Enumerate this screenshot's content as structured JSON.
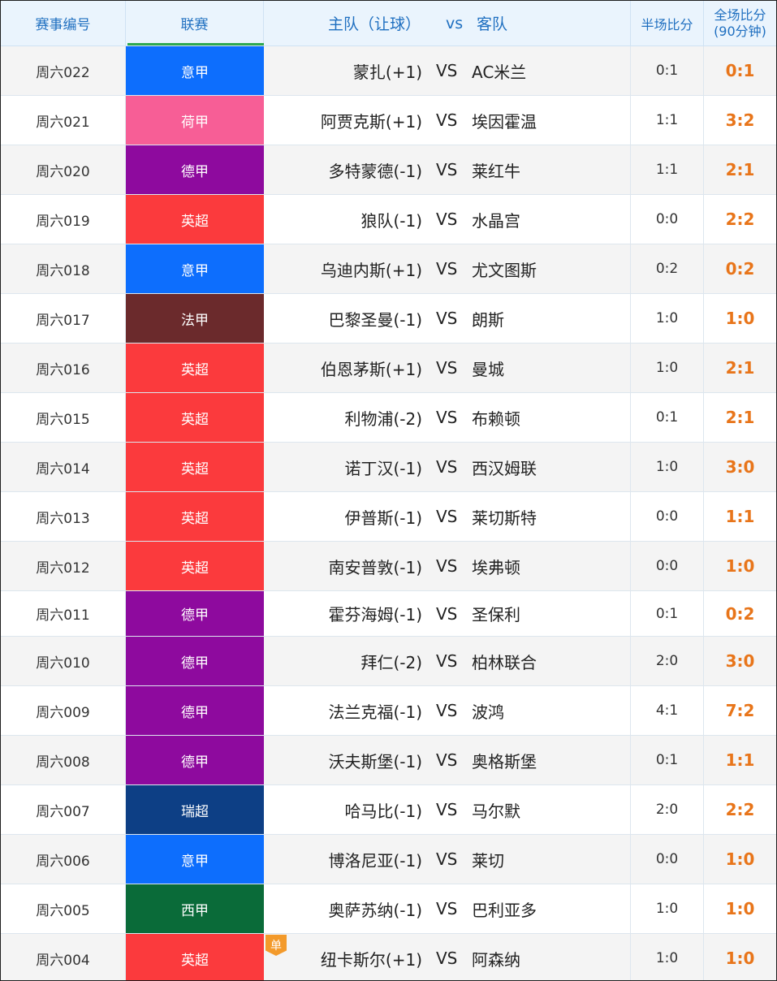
{
  "header": {
    "id": "赛事编号",
    "league": "联赛",
    "home": "主队（让球）",
    "vs": "vs",
    "away": "客队",
    "half": "半场比分",
    "full_line1": "全场比分",
    "full_line2": "(90分钟)"
  },
  "league_colors": {
    "意甲": "#0d6efd",
    "荷甲": "#f75e96",
    "德甲": "#8e0a9e",
    "英超": "#fb3a3d",
    "法甲": "#6b2a2c",
    "瑞超": "#0d3f85",
    "西甲": "#0a6b39"
  },
  "score_color": "#e8751a",
  "single_tag": "单",
  "rows": [
    {
      "id": "周六022",
      "league": "意甲",
      "home": "蒙扎(+1)",
      "vs": "VS",
      "away": "AC米兰",
      "half": "0:1",
      "full": "0:1"
    },
    {
      "id": "周六021",
      "league": "荷甲",
      "home": "阿贾克斯(+1)",
      "vs": "VS",
      "away": "埃因霍温",
      "half": "1:1",
      "full": "3:2"
    },
    {
      "id": "周六020",
      "league": "德甲",
      "home": "多特蒙德(-1)",
      "vs": "VS",
      "away": "莱红牛",
      "half": "1:1",
      "full": "2:1"
    },
    {
      "id": "周六019",
      "league": "英超",
      "home": "狼队(-1)",
      "vs": "VS",
      "away": "水晶宫",
      "half": "0:0",
      "full": "2:2"
    },
    {
      "id": "周六018",
      "league": "意甲",
      "home": "乌迪内斯(+1)",
      "vs": "VS",
      "away": "尤文图斯",
      "half": "0:2",
      "full": "0:2"
    },
    {
      "id": "周六017",
      "league": "法甲",
      "home": "巴黎圣曼(-1)",
      "vs": "VS",
      "away": "朗斯",
      "half": "1:0",
      "full": "1:0"
    },
    {
      "id": "周六016",
      "league": "英超",
      "home": "伯恩茅斯(+1)",
      "vs": "VS",
      "away": "曼城",
      "half": "1:0",
      "full": "2:1"
    },
    {
      "id": "周六015",
      "league": "英超",
      "home": "利物浦(-2)",
      "vs": "VS",
      "away": "布赖顿",
      "half": "0:1",
      "full": "2:1"
    },
    {
      "id": "周六014",
      "league": "英超",
      "home": "诺丁汉(-1)",
      "vs": "VS",
      "away": "西汉姆联",
      "half": "1:0",
      "full": "3:0"
    },
    {
      "id": "周六013",
      "league": "英超",
      "home": "伊普斯(-1)",
      "vs": "VS",
      "away": "莱切斯特",
      "half": "0:0",
      "full": "1:1"
    },
    {
      "id": "周六012",
      "league": "英超",
      "home": "南安普敦(-1)",
      "vs": "VS",
      "away": "埃弗顿",
      "half": "0:0",
      "full": "1:0"
    },
    {
      "id": "周六011",
      "league": "德甲",
      "home": "霍芬海姆(-1)",
      "vs": "VS",
      "away": "圣保利",
      "half": "0:1",
      "full": "0:2"
    },
    {
      "id": "周六010",
      "league": "德甲",
      "home": "拜仁(-2)",
      "vs": "VS",
      "away": "柏林联合",
      "half": "2:0",
      "full": "3:0"
    },
    {
      "id": "周六009",
      "league": "德甲",
      "home": "法兰克福(-1)",
      "vs": "VS",
      "away": "波鸿",
      "half": "4:1",
      "full": "7:2"
    },
    {
      "id": "周六008",
      "league": "德甲",
      "home": "沃夫斯堡(-1)",
      "vs": "VS",
      "away": "奥格斯堡",
      "half": "0:1",
      "full": "1:1"
    },
    {
      "id": "周六007",
      "league": "瑞超",
      "home": "哈马比(-1)",
      "vs": "VS",
      "away": "马尔默",
      "half": "2:0",
      "full": "2:2"
    },
    {
      "id": "周六006",
      "league": "意甲",
      "home": "博洛尼亚(-1)",
      "vs": "VS",
      "away": "莱切",
      "half": "0:0",
      "full": "1:0"
    },
    {
      "id": "周六005",
      "league": "西甲",
      "home": "奥萨苏纳(-1)",
      "vs": "VS",
      "away": "巴利亚多",
      "half": "1:0",
      "full": "1:0"
    },
    {
      "id": "周六004",
      "league": "英超",
      "home": "纽卡斯尔(+1)",
      "vs": "VS",
      "away": "阿森纳",
      "half": "1:0",
      "full": "1:0"
    }
  ]
}
